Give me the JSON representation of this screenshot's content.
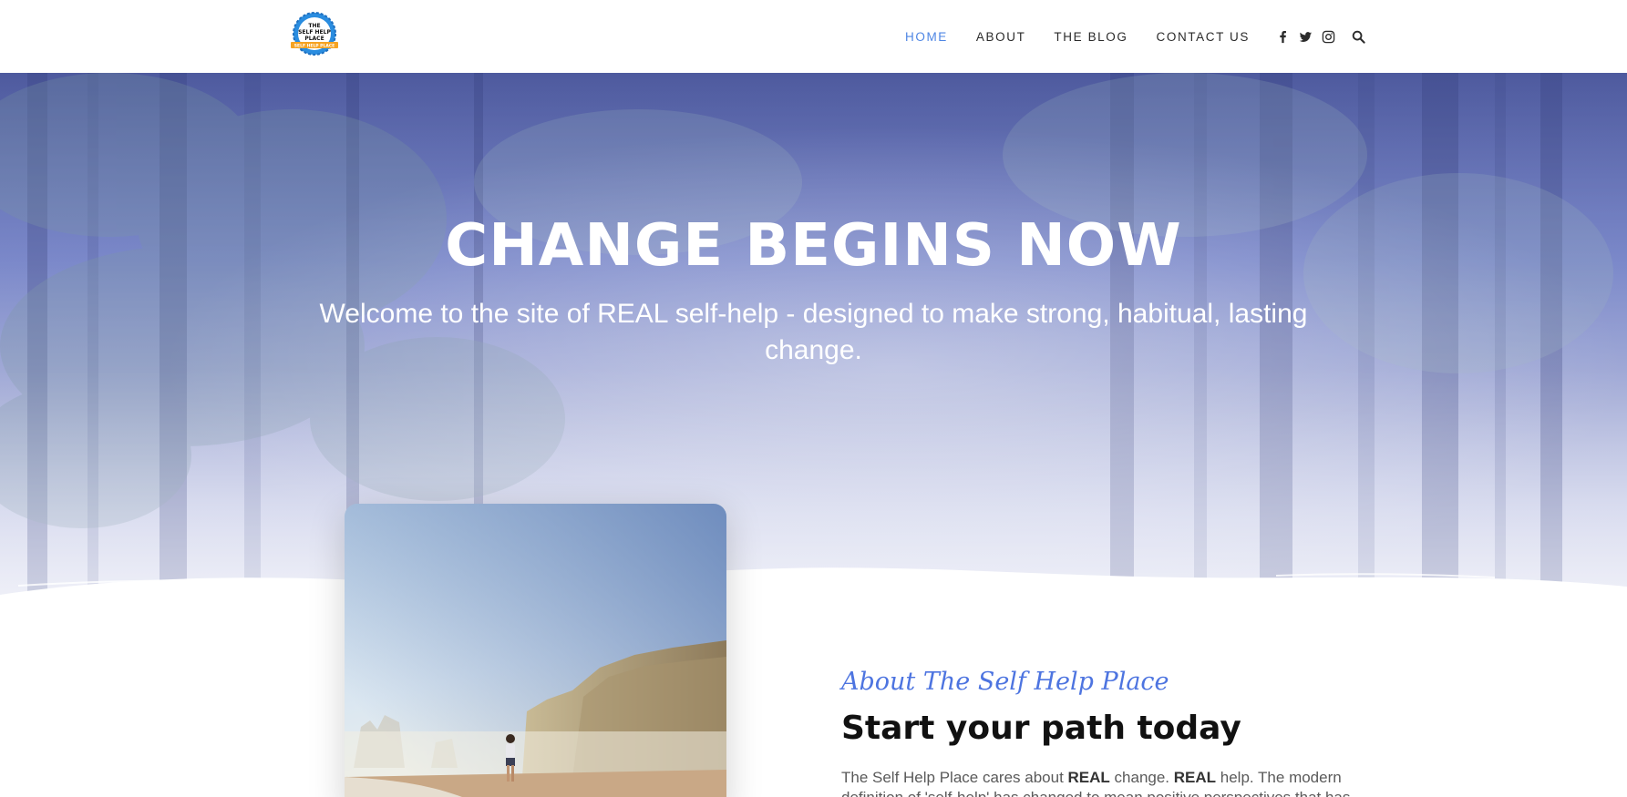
{
  "header": {
    "logo": {
      "text_lines": [
        "THE",
        "SELF HELP",
        "PLACE"
      ],
      "ribbon_text": "SELF HELP PLACE",
      "ring_color": "#2a8de0",
      "ribbon_color": "#f6a322"
    },
    "nav": [
      {
        "label": "HOME",
        "active": true
      },
      {
        "label": "ABOUT",
        "active": false
      },
      {
        "label": "THE BLOG",
        "active": false
      },
      {
        "label": "CONTACT US",
        "active": false
      }
    ],
    "social_icons": [
      "facebook-icon",
      "twitter-icon",
      "instagram-icon"
    ],
    "search_icon": "search-icon",
    "active_color": "#4e86e4"
  },
  "hero": {
    "title": "CHANGE BEGINS NOW",
    "subtitle": "Welcome to the site of REAL self-help - designed to make strong, habitual, lasting change."
  },
  "about": {
    "kicker": "About The Self Help Place",
    "heading": "Start your path today",
    "body_parts": [
      {
        "text": "The Self Help Place cares about ",
        "bold": false
      },
      {
        "text": "REAL",
        "bold": true
      },
      {
        "text": " change. ",
        "bold": false
      },
      {
        "text": "REAL",
        "bold": true
      },
      {
        "text": " help. The modern definition of 'self-help' has changed to mean positive perspectives that has",
        "bold": false
      }
    ],
    "kicker_color": "#4d74e0"
  }
}
